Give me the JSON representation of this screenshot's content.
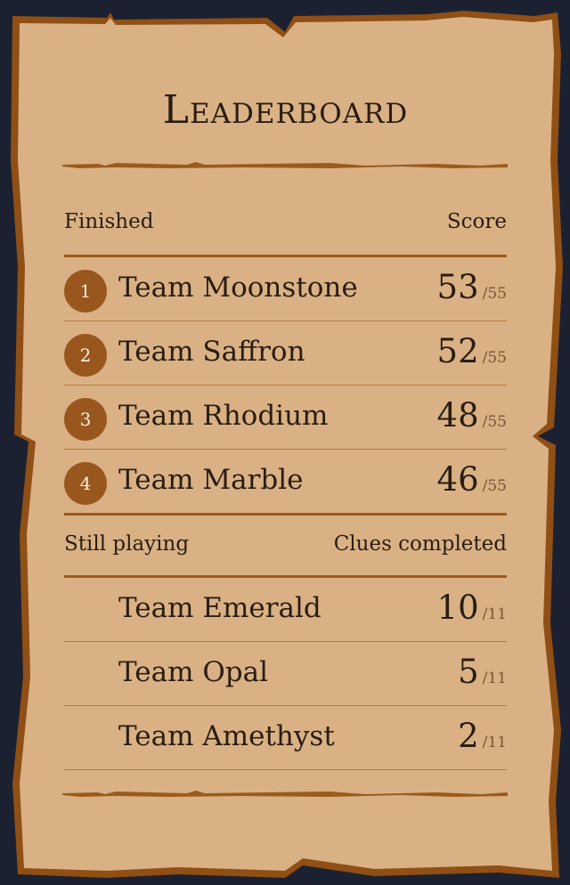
{
  "title": "Leaderboard",
  "finished": {
    "label": "Finished",
    "score_label": "Score",
    "teams": [
      {
        "rank": "1",
        "name": "Team Moonstone",
        "score": "53",
        "max": "/55"
      },
      {
        "rank": "2",
        "name": "Team Saffron",
        "score": "52",
        "max": "/55"
      },
      {
        "rank": "3",
        "name": "Team Rhodium",
        "score": "48",
        "max": "/55"
      },
      {
        "rank": "4",
        "name": "Team Marble",
        "score": "46",
        "max": "/55"
      }
    ]
  },
  "playing": {
    "label": "Still playing",
    "score_label": "Clues completed",
    "teams": [
      {
        "name": "Team Emerald",
        "score": "10",
        "max": "/11"
      },
      {
        "name": "Team Opal",
        "score": "5",
        "max": "/11"
      },
      {
        "name": "Team Amethyst",
        "score": "2",
        "max": "/11"
      }
    ]
  },
  "colors": {
    "background": "#1b2130",
    "parchment": "#d9b184",
    "parchment_edge": "#8f4f15",
    "badge": "#99561d",
    "text": "#2a1d12"
  }
}
